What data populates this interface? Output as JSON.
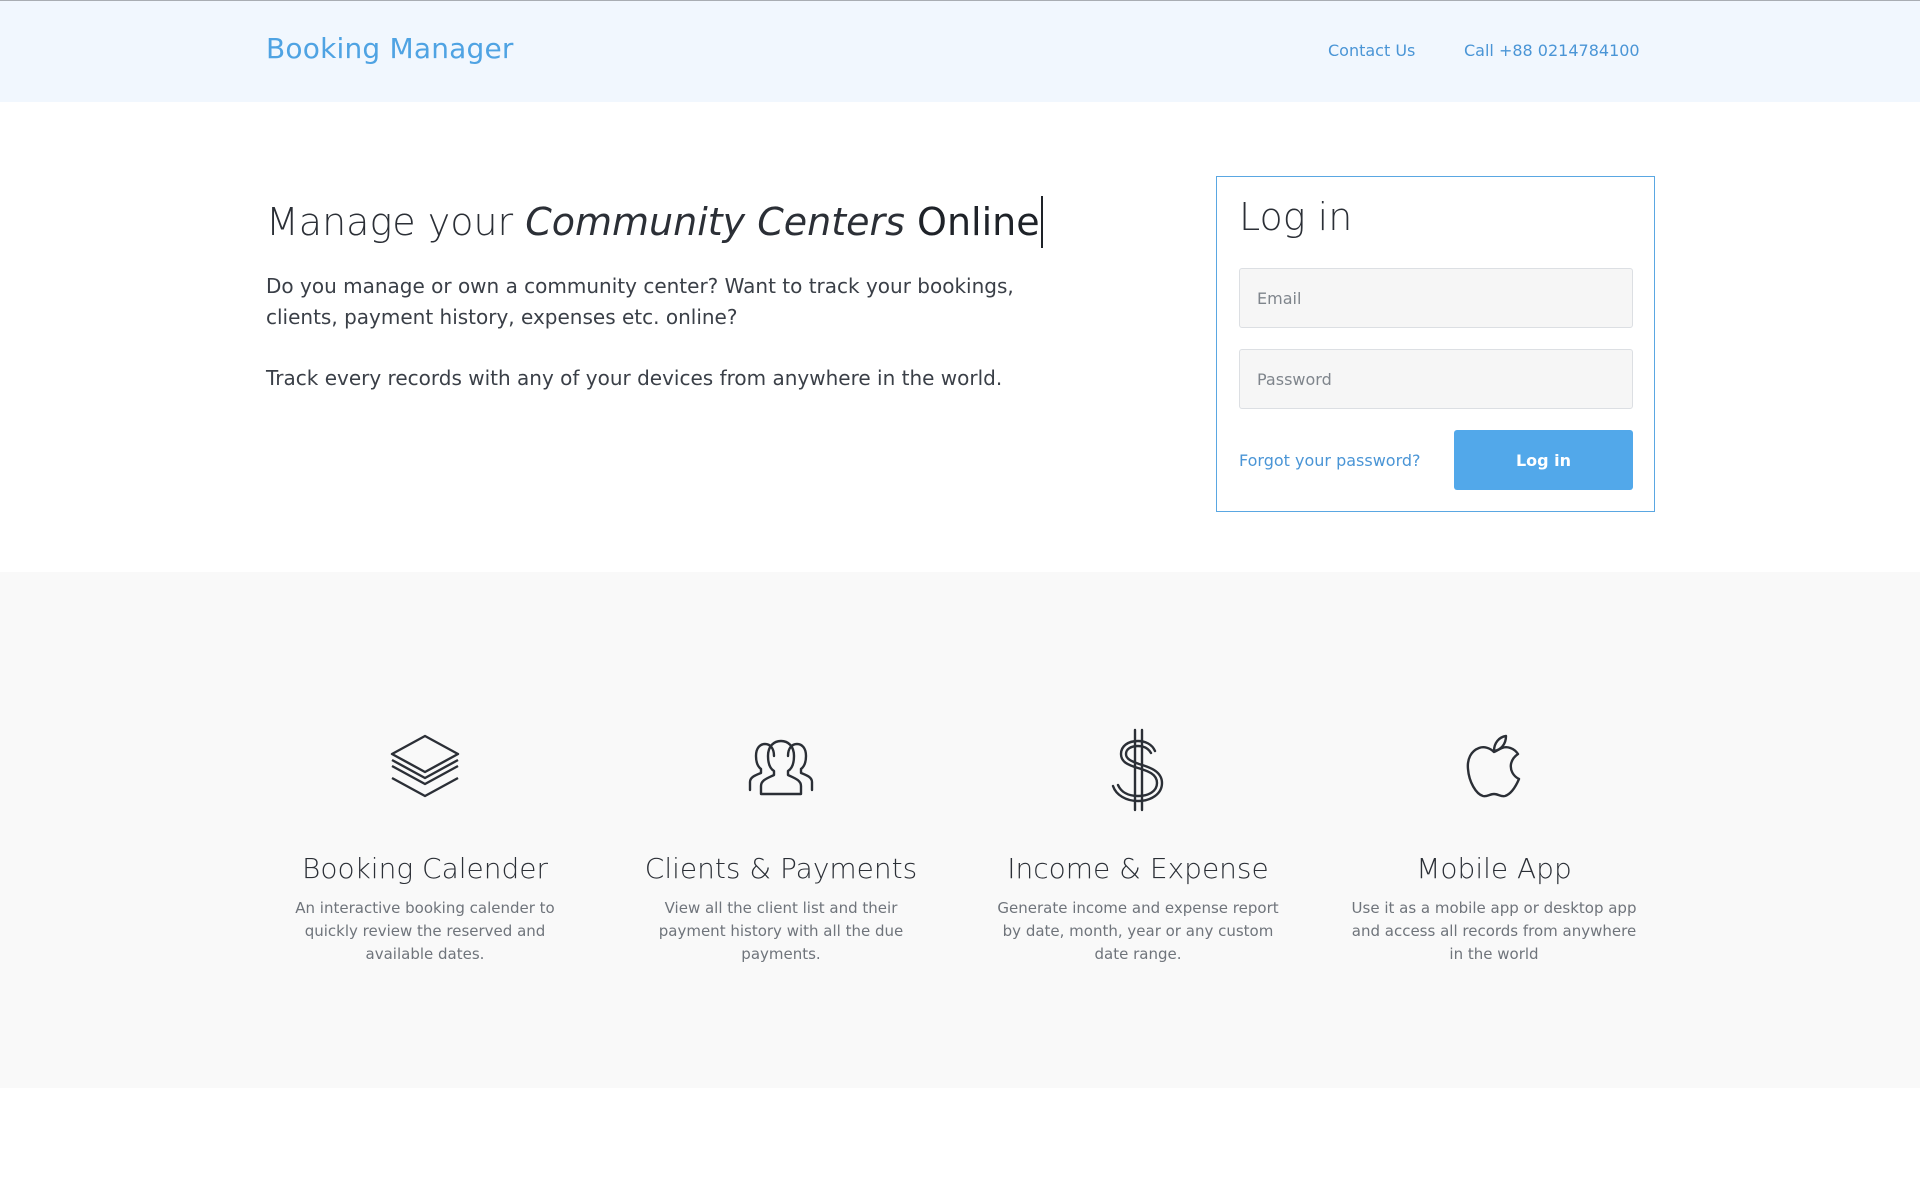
{
  "header": {
    "brand": "Booking Manager",
    "contact_label": "Contact Us",
    "call_label": "Call +88 0214784100"
  },
  "hero": {
    "title_prefix": "Manage your ",
    "title_italic": "Community Centers",
    "title_bold": "Online",
    "paragraph1": "Do you manage or own a community center? Want to track your bookings, clients, payment history, expenses etc. online?",
    "paragraph2": "Track every records with any of your devices from anywhere in the world."
  },
  "login": {
    "title": "Log in",
    "email_placeholder": "Email",
    "email_value": "",
    "password_placeholder": "Password",
    "password_value": "",
    "forgot_label": "Forgot your password?",
    "submit_label": "Log in"
  },
  "features": [
    {
      "icon": "layers-icon",
      "title": "Booking Calender",
      "description": "An interactive booking calender to quickly review the reserved and available dates."
    },
    {
      "icon": "users-icon",
      "title": "Clients & Payments",
      "description": "View all the client list and their payment history with all the due payments."
    },
    {
      "icon": "dollar-icon",
      "title": "Income & Expense",
      "description": "Generate income and expense report by date, month, year or any custom date range."
    },
    {
      "icon": "apple-icon",
      "title": "Mobile App",
      "description": "Use it as a mobile app or desktop app and access all records from anywhere in the world"
    }
  ],
  "colors": {
    "accent": "#4fa3e3",
    "button": "#52a8ea",
    "header_bg": "#f1f7fe",
    "features_bg": "#f9f9f9",
    "text": "#2b2f36",
    "muted_text": "#6f747b"
  }
}
